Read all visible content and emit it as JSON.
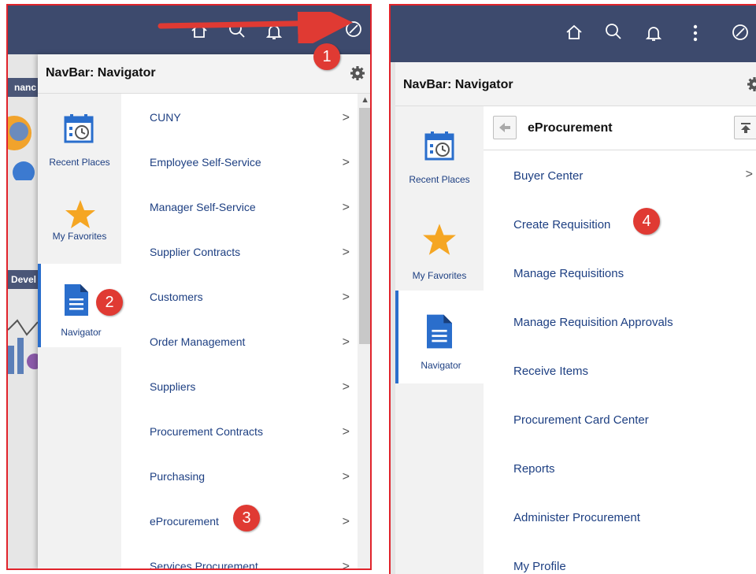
{
  "colors": {
    "topbar": "#3d4a6d",
    "link": "#1d3f82",
    "badge": "#e03a33",
    "frame": "#e0232b",
    "active_indicator": "#2a6ecc",
    "favorite_star": "#f5a623"
  },
  "left_panel": {
    "topbar_icons": [
      "home-icon",
      "search-icon",
      "bell-icon",
      "more-icon",
      "navbar-icon"
    ],
    "background_labels": [
      "nanc",
      "Devel"
    ],
    "drawer_title": "NavBar: Navigator",
    "sidebar": [
      {
        "label": "Recent Places",
        "icon": "recent-places-icon"
      },
      {
        "label": "My Favorites",
        "icon": "star-icon"
      },
      {
        "label": "Navigator",
        "icon": "navigator-icon",
        "active": true
      }
    ],
    "menu_items": [
      "CUNY",
      "Employee Self-Service",
      "Manager Self-Service",
      "Supplier Contracts",
      "Customers",
      "Order Management",
      "Suppliers",
      "Procurement Contracts",
      "Purchasing",
      "eProcurement",
      "Services Procurement"
    ],
    "chevron": ">"
  },
  "right_panel": {
    "topbar_icons": [
      "home-icon",
      "search-icon",
      "bell-icon",
      "more-icon",
      "navbar-icon"
    ],
    "drawer_title": "NavBar: Navigator",
    "sidebar": [
      {
        "label": "Recent Places",
        "icon": "recent-places-icon"
      },
      {
        "label": "My Favorites",
        "icon": "star-icon"
      },
      {
        "label": "Navigator",
        "icon": "navigator-icon",
        "active": true
      }
    ],
    "breadcrumb_title": "eProcurement",
    "menu_items": [
      {
        "label": "Buyer Center",
        "has_children": true
      },
      {
        "label": "Create Requisition"
      },
      {
        "label": "Manage Requisitions"
      },
      {
        "label": "Manage Requisition Approvals"
      },
      {
        "label": "Receive Items"
      },
      {
        "label": "Procurement Card Center"
      },
      {
        "label": "Reports"
      },
      {
        "label": "Administer Procurement"
      },
      {
        "label": "My Profile"
      }
    ],
    "chevron": ">"
  },
  "annotations": {
    "step1": "1",
    "step2": "2",
    "step3": "3",
    "step4": "4"
  }
}
